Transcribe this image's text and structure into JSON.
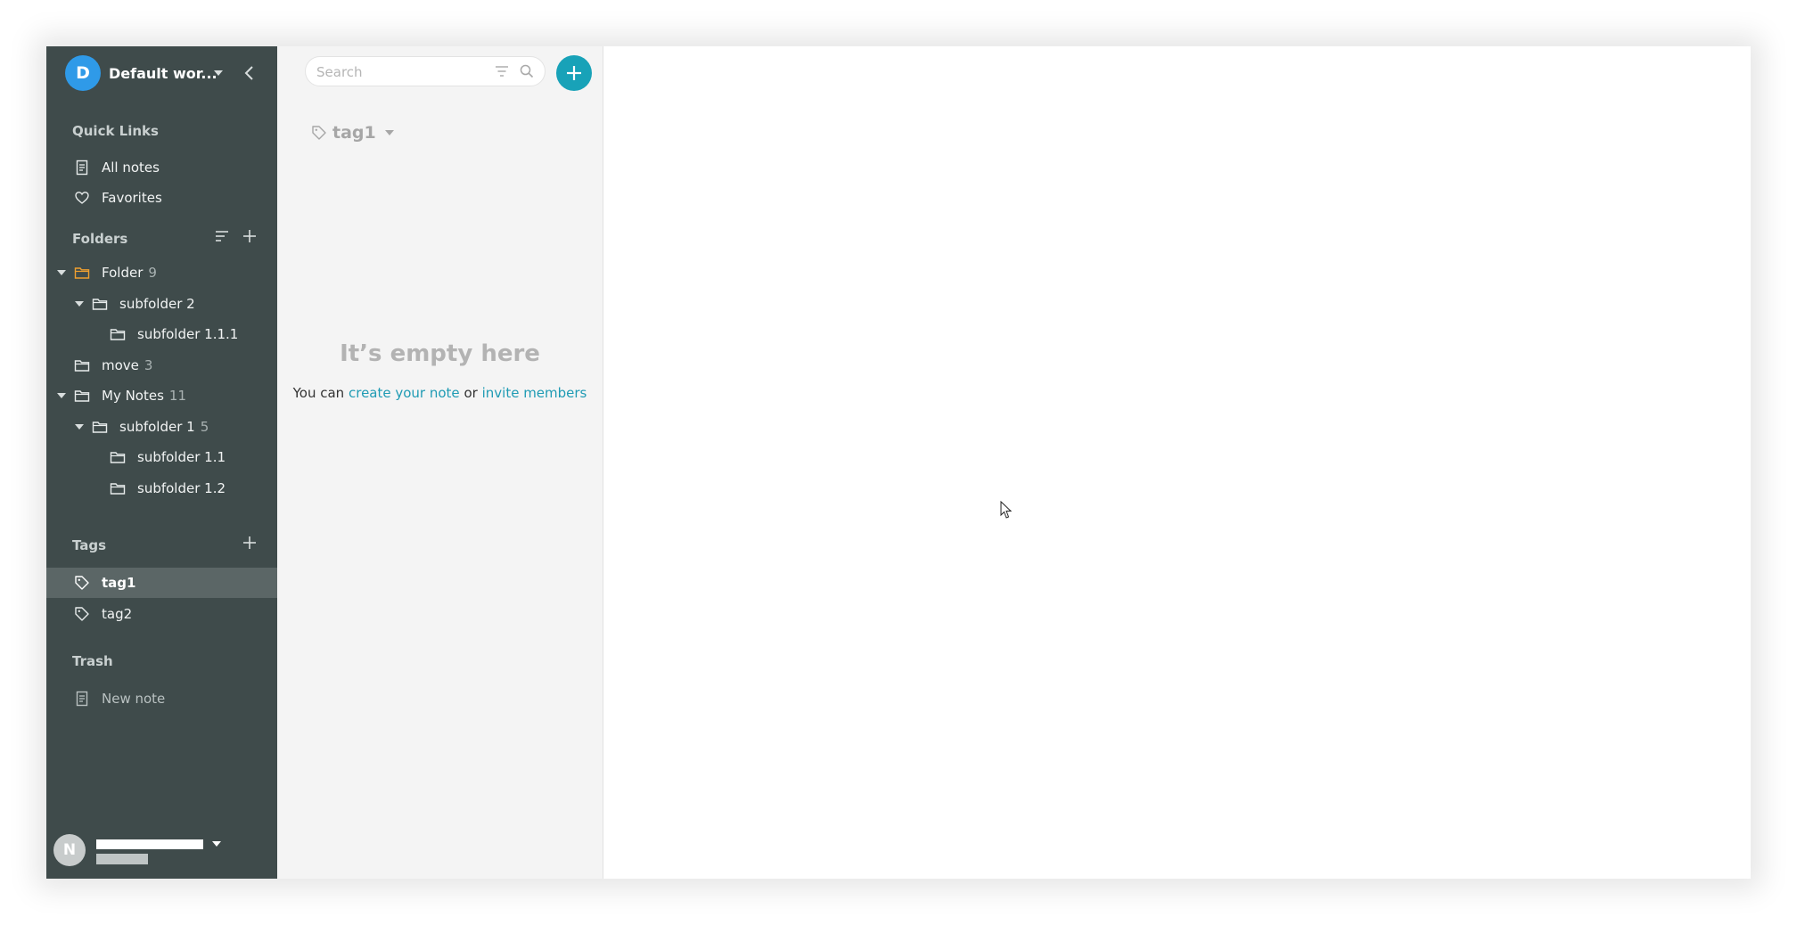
{
  "workspace": {
    "avatar_letter": "D",
    "name": "Default wor..."
  },
  "quick_links": {
    "title": "Quick Links",
    "items": [
      {
        "label": "All notes",
        "icon": "note-icon"
      },
      {
        "label": "Favorites",
        "icon": "heart-icon"
      }
    ]
  },
  "folders": {
    "title": "Folders",
    "items": [
      {
        "label": "Folder",
        "count": "9"
      },
      {
        "label": "subfolder 2",
        "count": ""
      },
      {
        "label": "subfolder 1.1.1",
        "count": ""
      },
      {
        "label": "move",
        "count": "3"
      },
      {
        "label": "My Notes",
        "count": "11"
      },
      {
        "label": "subfolder 1",
        "count": "5"
      },
      {
        "label": "subfolder 1.1",
        "count": ""
      },
      {
        "label": "subfolder 1.2",
        "count": ""
      }
    ]
  },
  "tags": {
    "title": "Tags",
    "items": [
      {
        "label": "tag1"
      },
      {
        "label": "tag2"
      }
    ]
  },
  "trash": {
    "title": "Trash",
    "items": [
      {
        "label": "New note"
      }
    ]
  },
  "user": {
    "avatar_letter": "N"
  },
  "search": {
    "placeholder": "Search"
  },
  "notelist": {
    "current_tag": "tag1",
    "empty_title": "It’s empty here",
    "empty_prefix": "You can",
    "create_link": "create your note",
    "or_text": "or",
    "invite_link": "invite members"
  },
  "colors": {
    "sidebar_bg": "#3f4b4b",
    "accent": "#18a2b8",
    "folder_highlight": "#f0a030"
  }
}
